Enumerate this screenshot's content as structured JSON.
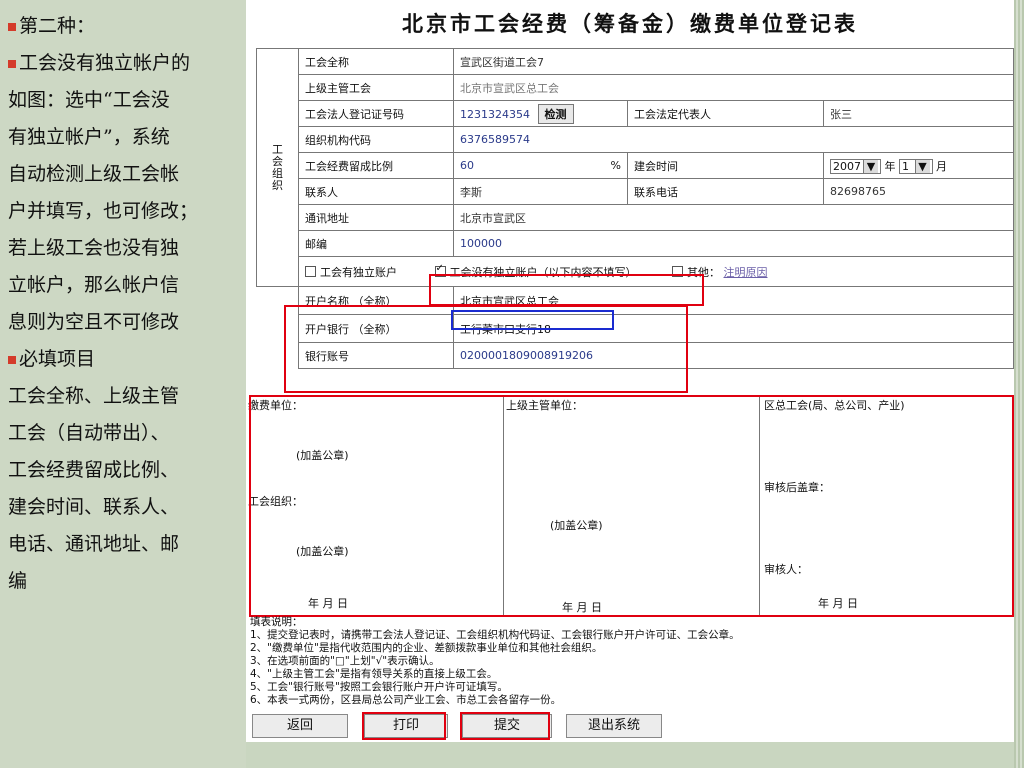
{
  "left_panel": {
    "lines": [
      {
        "bullet": true,
        "text": "第二种："
      },
      {
        "bullet": true,
        "text": "工会没有独立帐户的"
      },
      {
        "bullet": false,
        "text": "如图：选中“工会没"
      },
      {
        "bullet": false,
        "text": "有独立帐户”，系统"
      },
      {
        "bullet": false,
        "text": "自动检测上级工会帐"
      },
      {
        "bullet": false,
        "text": "户并填写，也可修改；"
      },
      {
        "bullet": false,
        "text": "若上级工会也没有独"
      },
      {
        "bullet": false,
        "text": "立帐户，那么帐户信"
      },
      {
        "bullet": false,
        "text": "息则为空且不可修改"
      },
      {
        "bullet": true,
        "text": "必填项目"
      },
      {
        "bullet": false,
        "text": "工会全称、上级主管"
      },
      {
        "bullet": false,
        "text": "工会（自动带出）、"
      },
      {
        "bullet": false,
        "text": "工会经费留成比例、"
      },
      {
        "bullet": false,
        "text": "建会时间、联系人、"
      },
      {
        "bullet": false,
        "text": "电话、通讯地址、邮"
      },
      {
        "bullet": false,
        "text": "编"
      }
    ]
  },
  "form": {
    "title": "北京市工会经费（筹备金）缴费单位登记表",
    "section_label": "工会组织",
    "union_name_label": "工会全称",
    "union_name_value": "宣武区街道工会7",
    "parent_union_label": "上级主管工会",
    "parent_union_value": "北京市宣武区总工会",
    "legal_cert_label": "工会法人登记证号码",
    "legal_cert_value": "1231324354",
    "check_button": "检测",
    "legal_rep_label": "工会法定代表人",
    "legal_rep_value": "张三",
    "org_code_label": "组织机构代码",
    "org_code_value": "6376589574",
    "retention_label": "工会经费留成比例",
    "retention_value": "60",
    "percent_sign": "%",
    "founded_label": "建会时间",
    "founded_year": "2007",
    "year_unit": "年",
    "founded_month": "1",
    "month_unit": "月",
    "contact_label": "联系人",
    "contact_value": "李斯",
    "phone_label": "联系电话",
    "phone_value": "82698765",
    "address_label": "通讯地址",
    "address_value": "北京市宣武区",
    "postcode_label": "邮编",
    "postcode_value": "100000",
    "opt_independent": "工会有独立账户",
    "opt_no_independent": "工会没有独立账户（以下内容不填写）",
    "opt_other": "其他：",
    "opt_other_link": "注明原因",
    "account_name_label": "开户名称 （全称）",
    "account_name_value": "北京市宣武区总工会",
    "bank_label": "开户银行 （全称）",
    "bank_value": "工行菜市口支行18",
    "account_no_label": "银行账号",
    "account_no_value": "0200001809008919206"
  },
  "signatures": {
    "payer_label": "缴费单位：",
    "stamp1": "(加盖公章)",
    "union_org_label": "工会组织：",
    "stamp2": "(加盖公章)",
    "date_payer": "年    月    日",
    "superior_label": "上级主管单位：",
    "stamp3": "(加盖公章)",
    "date_superior": "年    月    日",
    "district_label": "区总工会(局、总公司、产业)",
    "reviewed_stamp": "审核后盖章：",
    "reviewer": "审核人：",
    "date_district": "年    月    日"
  },
  "notes": {
    "heading": "填表说明：",
    "items": [
      "1、提交登记表时，请携带工会法人登记证、工会组织机构代码证、工会银行账户开户许可证、工会公章。",
      "2、\"缴费单位\"是指代收范围内的企业、差额拨款事业单位和其他社会组织。",
      "3、在选项前面的\"□\"上划\"√\"表示确认。",
      "4、\"上级主管工会\"是指有领导关系的直接上级工会。",
      "5、工会\"银行账号\"按照工会银行账户开户许可证填写。",
      "6、本表一式两份，区县局总公司产业工会、市总工会各留存一份。"
    ]
  },
  "buttons": {
    "back": "返回",
    "print": "打印",
    "submit": "提交",
    "exit": "退出系统"
  },
  "colors": {
    "highlight_red": "#e00010",
    "highlight_blue": "#1a2bd0",
    "bullet": "#d43b2a",
    "panel_bg": "#cdd8c4"
  }
}
